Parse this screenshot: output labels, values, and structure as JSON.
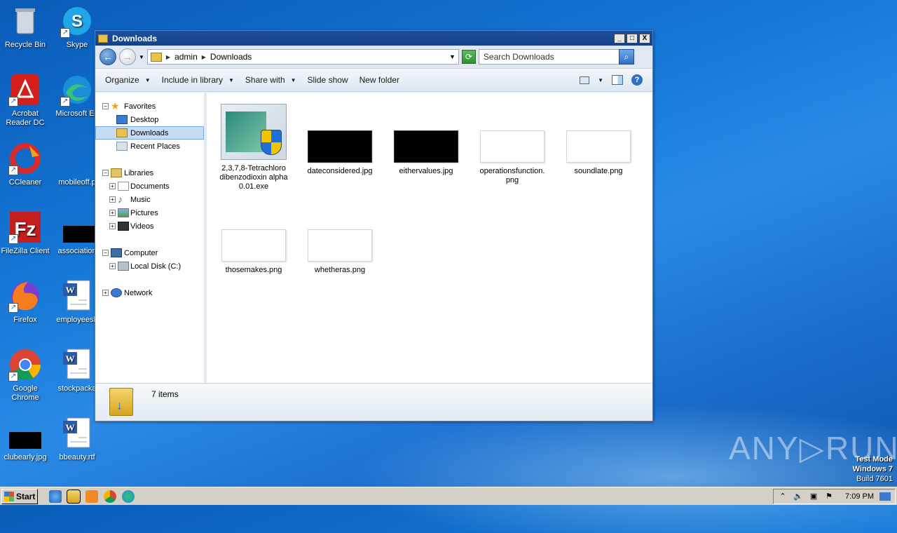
{
  "desktop": {
    "icons": [
      {
        "label": "Recycle Bin",
        "icon": "recycle-bin-icon"
      },
      {
        "label": "Skype",
        "icon": "skype-icon"
      },
      {
        "label": "Acrobat Reader DC",
        "icon": "acrobat-icon"
      },
      {
        "label": "Microsoft Ed",
        "icon": "edge-icon"
      },
      {
        "label": "CCleaner",
        "icon": "ccleaner-icon"
      },
      {
        "label": "mobileoff.p",
        "icon": "file-icon"
      },
      {
        "label": "FileZilla Client",
        "icon": "filezilla-icon"
      },
      {
        "label": "association",
        "icon": "image-file-icon"
      },
      {
        "label": "Firefox",
        "icon": "firefox-icon"
      },
      {
        "label": "employeesh",
        "icon": "word-doc-icon"
      },
      {
        "label": "Google Chrome",
        "icon": "chrome-icon"
      },
      {
        "label": "stockpacka",
        "icon": "word-doc-icon"
      },
      {
        "label": "clubearly.jpg",
        "icon": "image-file-icon"
      },
      {
        "label": "bbeauty.rtf",
        "icon": "word-doc-icon"
      }
    ]
  },
  "window": {
    "title": "Downloads",
    "buttons": {
      "minimize": "_",
      "maximize": "□",
      "close": "X"
    }
  },
  "address": {
    "crumbs": [
      "admin",
      "Downloads"
    ],
    "search_placeholder": "Search Downloads"
  },
  "toolbar": {
    "organize": "Organize",
    "include_library": "Include in library",
    "share_with": "Share with",
    "slide_show": "Slide show",
    "new_folder": "New folder"
  },
  "navpane": {
    "favorites": "Favorites",
    "desktop": "Desktop",
    "downloads": "Downloads",
    "recent": "Recent Places",
    "libraries": "Libraries",
    "documents": "Documents",
    "music": "Music",
    "pictures": "Pictures",
    "videos": "Videos",
    "computer": "Computer",
    "local_disk": "Local Disk (C:)",
    "network": "Network"
  },
  "files": [
    {
      "name": "2,3,7,8-Tetrachlorodibenzodioxin alpha 0.01.exe",
      "lines": [
        "2,3,7,8-Tetrachloro",
        "dibenzodioxin alpha",
        "0.01.exe"
      ],
      "type": "exe"
    },
    {
      "name": "dateconsidered.jpg",
      "lines": [
        "dateconsidered.jpg"
      ],
      "type": "dark"
    },
    {
      "name": "eithervalues.jpg",
      "lines": [
        "eithervalues.jpg"
      ],
      "type": "dark"
    },
    {
      "name": "operationsfunction.png",
      "lines": [
        "operationsfunction.",
        "png"
      ],
      "type": "light"
    },
    {
      "name": "soundlate.png",
      "lines": [
        "soundlate.png"
      ],
      "type": "light"
    },
    {
      "name": "thosemakes.png",
      "lines": [
        "thosemakes.png"
      ],
      "type": "light"
    },
    {
      "name": "whetheras.png",
      "lines": [
        "whetheras.png"
      ],
      "type": "light"
    }
  ],
  "status": {
    "count": "7 items"
  },
  "watermark": {
    "brand": "ANY▷RUN",
    "mode": "Test Mode",
    "os": "Windows 7",
    "build": "Build 7601"
  },
  "taskbar": {
    "start": "Start",
    "time": "7:09 PM"
  }
}
